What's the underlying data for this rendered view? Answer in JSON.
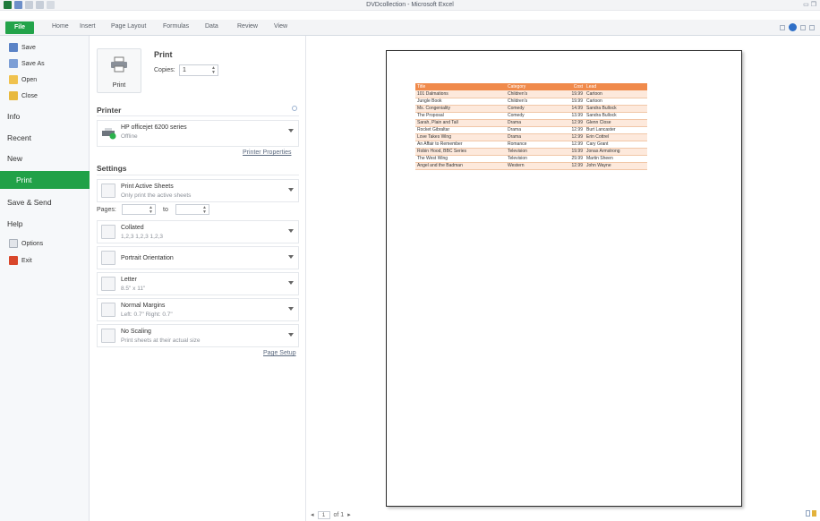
{
  "window": {
    "title": "DVDcollection - Microsoft Excel",
    "controls": "▭ ❐"
  },
  "ribbon": {
    "file_tab": "File",
    "tabs": [
      "Home",
      "Insert",
      "Page Layout",
      "Formulas",
      "Data",
      "Review",
      "View"
    ]
  },
  "nav": {
    "save": "Save",
    "save_as": "Save As",
    "open": "Open",
    "close": "Close",
    "info": "Info",
    "recent": "Recent",
    "new": "New",
    "print": "Print",
    "save_send": "Save & Send",
    "help": "Help",
    "options": "Options",
    "exit": "Exit"
  },
  "print": {
    "title": "Print",
    "button": "Print",
    "copies_label": "Copies:",
    "copies_value": "1"
  },
  "printer": {
    "heading": "Printer",
    "name": "HP officejet 6200 series",
    "status": "Offline",
    "properties_link": "Printer Properties"
  },
  "settings": {
    "heading": "Settings",
    "scope_title": "Print Active Sheets",
    "scope_sub": "Only print the active sheets",
    "pages_label": "Pages:",
    "to_label": "to",
    "collate_title": "Collated",
    "collate_sub": "1,2,3   1,2,3   1,2,3",
    "orientation": "Portrait Orientation",
    "paper_title": "Letter",
    "paper_sub": "8.5\" x 11\"",
    "margins_title": "Normal Margins",
    "margins_sub": "Left: 0.7\"   Right: 0.7\"",
    "scaling_title": "No Scaling",
    "scaling_sub": "Print sheets at their actual size",
    "page_setup_link": "Page Setup"
  },
  "preview": {
    "page_current": "1",
    "page_of": "of 1",
    "headers": [
      "Title",
      "Category",
      "Cost",
      "Lead"
    ],
    "rows": [
      [
        "101 Dalmations",
        "Children's",
        "19.99",
        "Cartoon"
      ],
      [
        "Jungle Book",
        "Children's",
        "19.99",
        "Cartoon"
      ],
      [
        "Ms. Congeniality",
        "Comedy",
        "14.99",
        "Sandra Bullock"
      ],
      [
        "The Proposal",
        "Comedy",
        "13.99",
        "Sandra Bullock"
      ],
      [
        "Sarah, Plain and Tall",
        "Drama",
        "12.99",
        "Glenn Close"
      ],
      [
        "Rocket Gibraltar",
        "Drama",
        "12.99",
        "Burt Lancaster"
      ],
      [
        "Love Takes Wing",
        "Drama",
        "12.99",
        "Erin Cottrel"
      ],
      [
        "An Affair to Remember",
        "Romance",
        "12.99",
        "Cary Grant"
      ],
      [
        "Robin Hood, BBC Series",
        "Television",
        "19.99",
        "Jonas Armstrong"
      ],
      [
        "The West Wing",
        "Television",
        "29.99",
        "Martin Sheen"
      ],
      [
        "Angel and the Badman",
        "Western",
        "12.99",
        "John Wayne"
      ]
    ]
  },
  "colors": {
    "accent_green": "#21a148",
    "header_orange": "#f08a4b",
    "band_peach": "#fde9dc"
  }
}
